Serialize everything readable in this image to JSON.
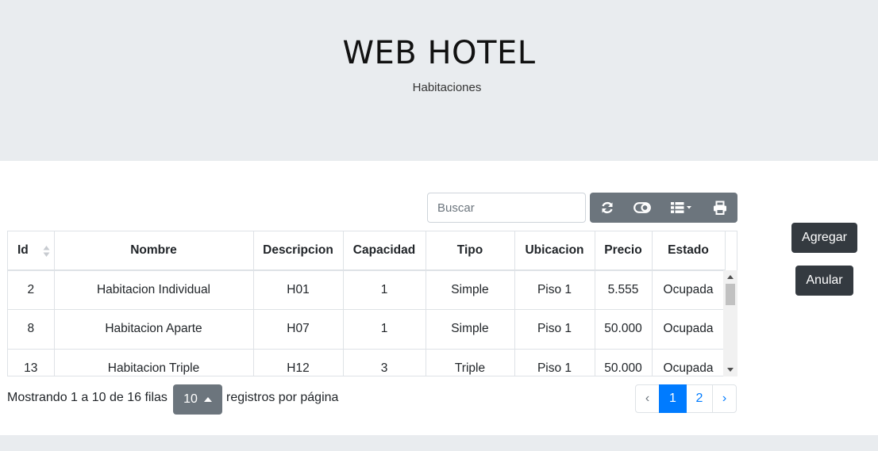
{
  "header": {
    "title": "WEB HOTEL",
    "subtitle": "Habitaciones"
  },
  "toolbar": {
    "search_placeholder": "Buscar",
    "buttons": [
      "refresh-icon",
      "toggle-icon",
      "columns-icon",
      "print-icon"
    ]
  },
  "actions": {
    "add_label": "Agregar",
    "void_label": "Anular"
  },
  "table": {
    "columns": [
      "Id",
      "Nombre",
      "Descripcion",
      "Capacidad",
      "Tipo",
      "Ubicacion",
      "Precio",
      "Estado"
    ],
    "rows": [
      [
        "2",
        "Habitacion Individual",
        "H01",
        "1",
        "Simple",
        "Piso 1",
        "5.555",
        "Ocupada"
      ],
      [
        "8",
        "Habitacion Aparte",
        "H07",
        "1",
        "Simple",
        "Piso 1",
        "50.000",
        "Ocupada"
      ],
      [
        "13",
        "Habitacion Triple",
        "H12",
        "3",
        "Triple",
        "Piso 1",
        "50.000",
        "Ocupada"
      ]
    ]
  },
  "pagination": {
    "info": "Mostrando 1 a 10 de 16 filas",
    "page_size": "10",
    "per_page_label": "registros por página",
    "prev": "‹",
    "pages": [
      "1",
      "2"
    ],
    "next": "›"
  },
  "colors": {
    "jumbotron": "#e9ecef",
    "secondary": "#6c757d",
    "dark": "#343a40",
    "primary": "#007bff"
  }
}
